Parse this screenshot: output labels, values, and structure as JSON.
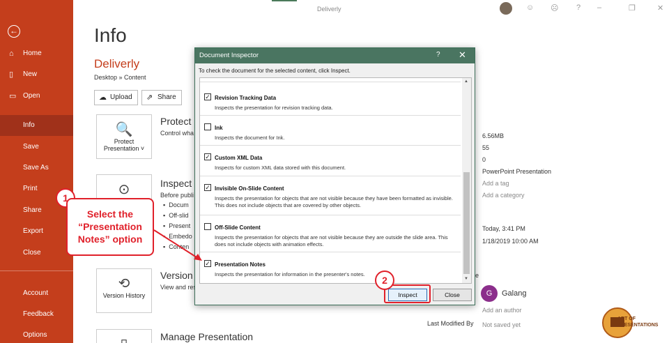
{
  "window": {
    "doc_title": "Deliverly"
  },
  "sidebar": {
    "items": [
      {
        "label": "Home",
        "icon": "home-icon"
      },
      {
        "label": "New",
        "icon": "new-file-icon"
      },
      {
        "label": "Open",
        "icon": "folder-icon"
      },
      {
        "label": "Info"
      },
      {
        "label": "Save"
      },
      {
        "label": "Save As"
      },
      {
        "label": "Print"
      },
      {
        "label": "Share"
      },
      {
        "label": "Export"
      },
      {
        "label": "Close"
      },
      {
        "label": "Account"
      },
      {
        "label": "Feedback"
      },
      {
        "label": "Options"
      }
    ]
  },
  "info": {
    "title": "Info",
    "file_name": "Deliverly",
    "path": "Desktop » Content",
    "upload_label": "Upload",
    "share_label": "Share",
    "protect": {
      "tile": "Protect Presentation ˅",
      "title": "Protect P",
      "desc": "Control wha"
    },
    "inspect": {
      "title": "Inspect P",
      "desc": "Before publi",
      "bullets": [
        "Docum",
        "Off-slid",
        "Present",
        "Embedo",
        "Conten"
      ]
    },
    "version": {
      "tile": "Version History",
      "title": "Version H",
      "desc": "View and res"
    },
    "manage": {
      "title": "Manage Presentation"
    }
  },
  "properties": {
    "size": "6.56MB",
    "slides": "55",
    "hidden": "0",
    "template": "PowerPoint Presentation",
    "tags": "Add a tag",
    "categories": "Add a category",
    "modified": "Today, 3:41 PM",
    "created": "1/18/2019 10:00 AM",
    "author_initial": "G",
    "author_name": "Galang",
    "add_author": "Add an author",
    "last_modified_label": "Last Modified By",
    "last_modified_value": "Not saved yet",
    "cut_letter": "e"
  },
  "dialog": {
    "title": "Document Inspector",
    "help": "?",
    "close": "✕",
    "instruction": "To check the document for the selected content, click Inspect.",
    "items": [
      {
        "title": "Revision Tracking Data",
        "desc": "Inspects the presentation for revision tracking data.",
        "checked": true
      },
      {
        "title": "Ink",
        "desc": "Inspects the document for Ink.",
        "checked": false
      },
      {
        "title": "Custom XML Data",
        "desc": "Inspects for custom XML data stored with this document.",
        "checked": true
      },
      {
        "title": "Invisible On-Slide Content",
        "desc": "Inspects the presentation for objects that are not visible because they have been formatted as invisible. This does not include objects that are covered by other objects.",
        "checked": true
      },
      {
        "title": "Off-Slide Content",
        "desc": "Inspects the presentation for objects that are not visible because they are outside the slide area. This does not include objects with animation effects.",
        "checked": false
      },
      {
        "title": "Presentation Notes",
        "desc": "Inspects the presentation for information in the presenter's notes.",
        "checked": true
      }
    ],
    "inspect_label": "Inspect",
    "close_label": "Close"
  },
  "annotations": {
    "step1": "1",
    "step2": "2",
    "callout": "Select the “Presentation Notes” option"
  },
  "watermark": {
    "line1": "ART OF",
    "line2": "PRESENTATIONS"
  },
  "colors": {
    "accent": "#c43e1c",
    "dialog_title": "#4a7561",
    "annotation": "#e0202a"
  }
}
